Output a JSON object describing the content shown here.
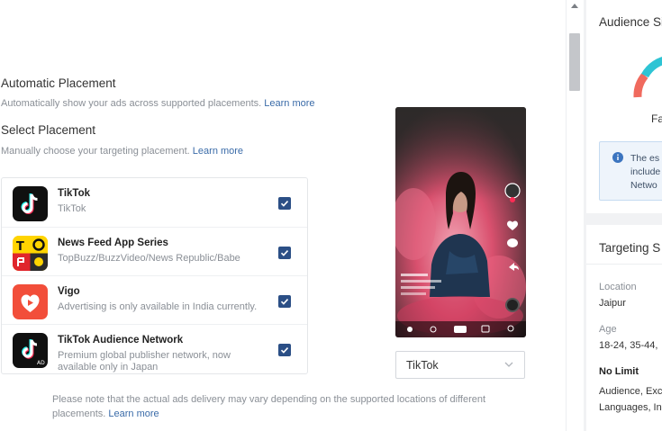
{
  "placement": {
    "automatic_title": "Automatic Placement",
    "automatic_desc": "Automatically show your ads across supported placements.",
    "automatic_link": "Learn more",
    "select_title": "Select Placement",
    "select_desc": "Manually choose your targeting placement.",
    "select_link": "Learn more",
    "items": [
      {
        "name": "TikTok",
        "desc": "TikTok",
        "checked": true,
        "icon": "tiktok-icon"
      },
      {
        "name": "News Feed App Series",
        "desc": "TopBuzz/BuzzVideo/News Republic/Babe",
        "checked": true,
        "icon": "news-feed-icon"
      },
      {
        "name": "Vigo",
        "desc": "Advertising is only available in India currently.",
        "checked": true,
        "icon": "vigo-icon"
      },
      {
        "name": "TikTok Audience Network",
        "desc": "Premium global publisher network, now available only in Japan",
        "checked": true,
        "icon": "tiktok-audience-network-icon"
      }
    ],
    "note": "Please note that the actual ads delivery may vary depending on the supported locations of different placements.",
    "note_link": "Learn more"
  },
  "preview": {
    "selected": "TikTok"
  },
  "audience_card": {
    "title": "Audience Si",
    "gauge_label": "Fa",
    "info_lines": [
      "The es",
      "include",
      "Netwo"
    ]
  },
  "targeting_card": {
    "title": "Targeting S",
    "location_label": "Location",
    "location_value": "Jaipur",
    "age_label": "Age",
    "age_value": "18-24, 35-44,",
    "no_limit": "No Limit",
    "no_limit_line1": "Audience, Exc",
    "no_limit_line2": "Languages, In"
  },
  "colors": {
    "accent": "#2b4f86",
    "link": "#3a6ba8",
    "gauge_teal": "#2ec4d4",
    "gauge_red": "#f06a5e"
  }
}
